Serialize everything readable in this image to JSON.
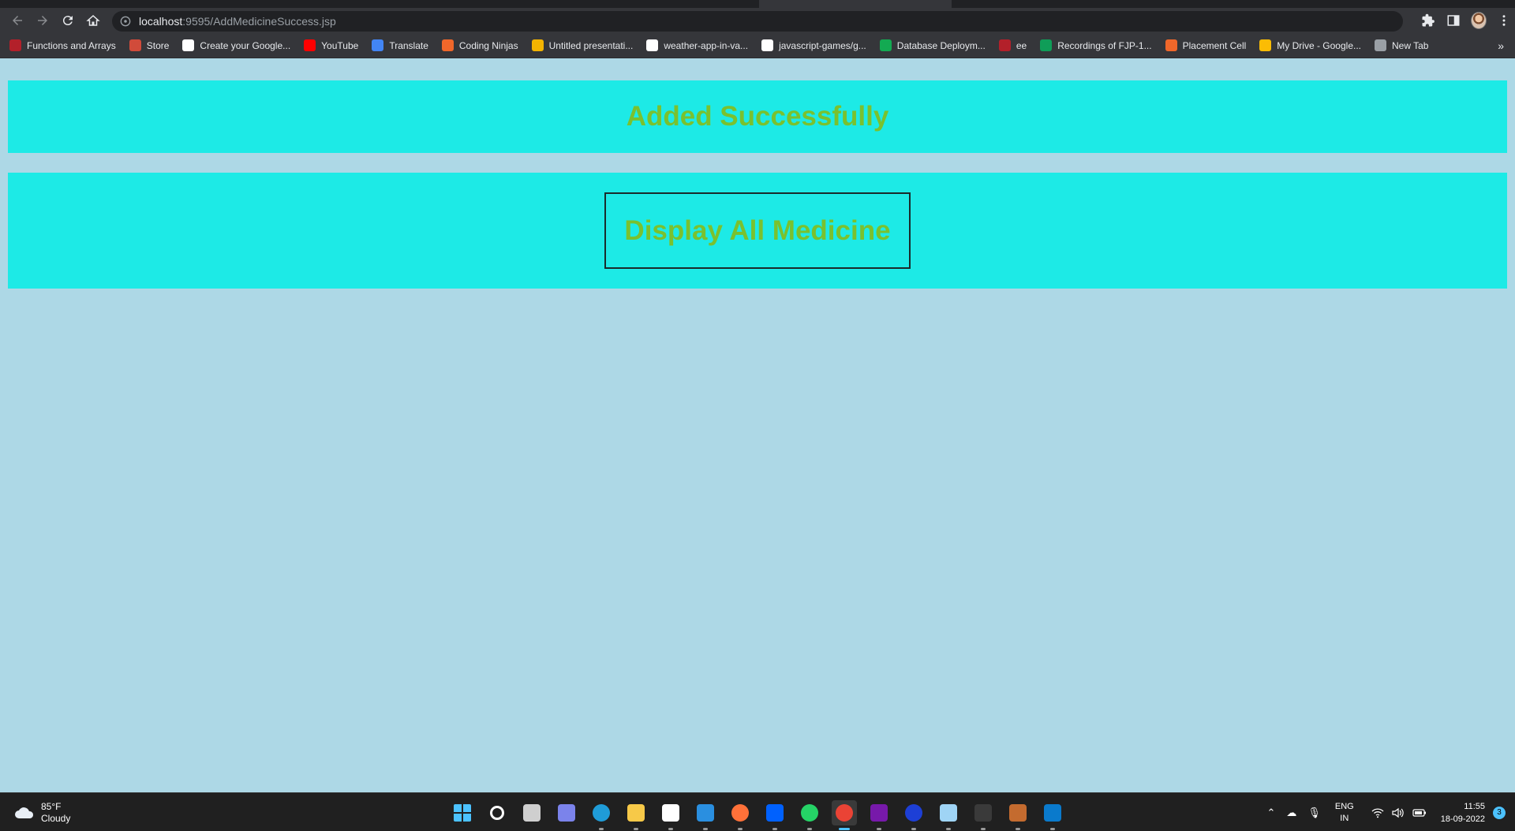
{
  "browser": {
    "url_host": "localhost",
    "url_path": ":9595/AddMedicineSuccess.jsp",
    "bookmarks": [
      {
        "label": "Functions and Arrays",
        "color": "#b3202a"
      },
      {
        "label": "Store",
        "color": "#d14b3a"
      },
      {
        "label": "Create your Google...",
        "color": "#ffffff"
      },
      {
        "label": "YouTube",
        "color": "#ff0000"
      },
      {
        "label": "Translate",
        "color": "#4285f4"
      },
      {
        "label": "Coding Ninjas",
        "color": "#f0672a"
      },
      {
        "label": "Untitled presentati...",
        "color": "#f4b400"
      },
      {
        "label": "weather-app-in-va...",
        "color": "#ffffff"
      },
      {
        "label": "javascript-games/g...",
        "color": "#ffffff"
      },
      {
        "label": "Database Deploym...",
        "color": "#13aa52"
      },
      {
        "label": "ee",
        "color": "#b3202a"
      },
      {
        "label": "Recordings of FJP-1...",
        "color": "#0f9d58"
      },
      {
        "label": "Placement Cell",
        "color": "#f0672a"
      },
      {
        "label": "My Drive - Google...",
        "color": "#fbbc04"
      },
      {
        "label": "New Tab",
        "color": "#9aa0a6"
      }
    ],
    "more_label": "»"
  },
  "page": {
    "heading": "Added Successfully",
    "display_button_label": "Display All Medicine",
    "accent_color": "#7ac12e",
    "banner_color": "#1deae6",
    "background_color": "#add8e6"
  },
  "taskbar": {
    "weather_temp": "85°F",
    "weather_desc": "Cloudy",
    "apps": [
      {
        "name": "start-icon",
        "color": "#4cc2ff"
      },
      {
        "name": "search-icon",
        "color": "#ffffff"
      },
      {
        "name": "task-view-icon",
        "color": "#cfcfcf"
      },
      {
        "name": "teams-chat-icon",
        "color": "#7b83eb"
      },
      {
        "name": "edge-icon",
        "color": "#1f9cd8"
      },
      {
        "name": "file-explorer-icon",
        "color": "#f7c948"
      },
      {
        "name": "microsoft-store-icon",
        "color": "#ffffff"
      },
      {
        "name": "mail-icon",
        "color": "#2a8fe0"
      },
      {
        "name": "firefox-icon",
        "color": "#ff7139"
      },
      {
        "name": "dropbox-icon",
        "color": "#0061fe"
      },
      {
        "name": "whatsapp-icon",
        "color": "#25d366"
      },
      {
        "name": "chrome-icon",
        "color": "#ea4335"
      },
      {
        "name": "onenote-icon",
        "color": "#7719aa"
      },
      {
        "name": "webex-icon",
        "color": "#1d3fd6"
      },
      {
        "name": "sketchup-icon",
        "color": "#9fd4f5"
      },
      {
        "name": "terminal-icon",
        "color": "#3a3a3a"
      },
      {
        "name": "settings-app-icon",
        "color": "#c46b2f"
      },
      {
        "name": "vscode-icon",
        "color": "#0a7acc"
      }
    ],
    "lang_line1": "ENG",
    "lang_line2": "IN",
    "time": "11:55",
    "date": "18-09-2022",
    "notifications": "3"
  }
}
